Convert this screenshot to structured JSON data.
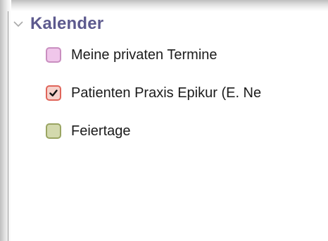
{
  "section": {
    "title": "Kalender",
    "expanded": true
  },
  "calendars": [
    {
      "label": "Meine privaten Termine",
      "checked": false,
      "fill": "#f0c6ea",
      "border": "#c98ec0"
    },
    {
      "label": "Patienten Praxis Epikur (E. Ne",
      "checked": true,
      "fill": "#f6d2cc",
      "border": "#e0655a"
    },
    {
      "label": "Feiertage",
      "checked": false,
      "fill": "#d3d9ad",
      "border": "#9aa562"
    }
  ],
  "colors": {
    "header_text": "#5d5a8e",
    "item_text": "#1b1b1b"
  }
}
